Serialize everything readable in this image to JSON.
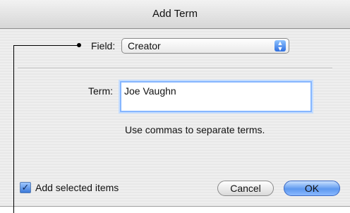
{
  "dialog": {
    "title": "Add Term",
    "field_label": "Field:",
    "field_value": "Creator",
    "term_label": "Term:",
    "term_value": "Joe Vaughn",
    "hint": "Use commas to separate terms.",
    "checkbox_label": "Add selected items",
    "checkbox_checked": true,
    "cancel_label": "Cancel",
    "ok_label": "OK"
  },
  "icons": {
    "popup_arrows": "updown-arrows-icon",
    "checkmark": "checkmark-icon"
  },
  "colors": {
    "accent": "#3c69c2",
    "focus_ring": "#86b6ff"
  }
}
